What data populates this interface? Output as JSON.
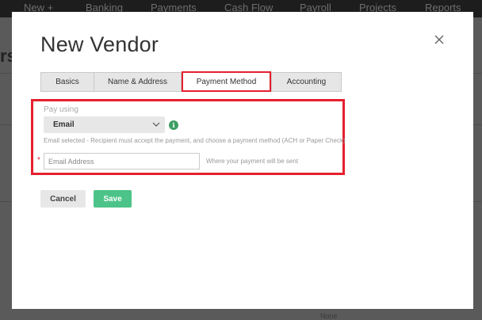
{
  "background": {
    "nav_items": [
      "New +",
      "Banking",
      "Payments",
      "Cash Flow",
      "Payroll",
      "Projects",
      "Reports"
    ],
    "fragments": [
      "rs",
      "None"
    ]
  },
  "modal": {
    "title": "New Vendor",
    "close_icon": "close-icon",
    "tabs": [
      {
        "label": "Basics",
        "active": false
      },
      {
        "label": "Name & Address",
        "active": false
      },
      {
        "label": "Payment Method",
        "active": true
      },
      {
        "label": "Accounting",
        "active": false
      }
    ],
    "payment": {
      "pay_using_label": "Pay using",
      "method_selected": "Email",
      "info_icon": "info-icon",
      "helper_text": "Email selected - Recipient must accept the payment, and choose a payment method (ACH or Paper Check)",
      "required_marker": "*",
      "email_placeholder": "Email Address",
      "email_value": "",
      "email_hint": "Where your payment will be sent"
    },
    "buttons": {
      "cancel": "Cancel",
      "save": "Save"
    }
  },
  "colors": {
    "highlight": "#e5202e",
    "save": "#4cc388",
    "info": "#3d9e63"
  }
}
